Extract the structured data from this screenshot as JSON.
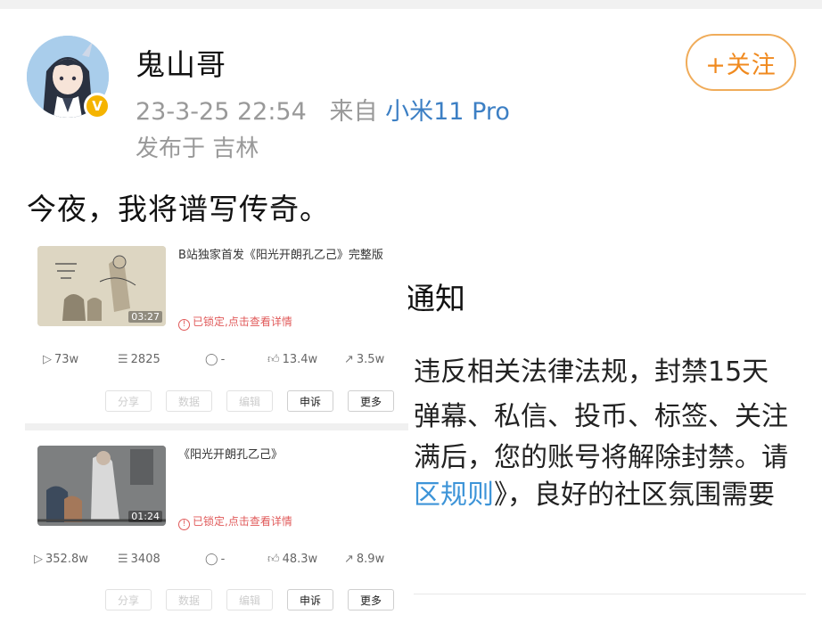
{
  "post": {
    "username": "鬼山哥",
    "timestamp": "23-3-25 22:54",
    "source_prefix": "来自",
    "device": "小米11 Pro",
    "location": "发布于 吉林",
    "follow_label": "+关注",
    "verified_icon": "v-badge-icon",
    "text": "今夜，我将谱写传奇。"
  },
  "videos": [
    {
      "title": "B站独家首发《阳光开朗孔乙己》完整版",
      "duration": "03:27",
      "lock_notice": "已锁定,点击查看详情",
      "stats": {
        "plays": "73w",
        "danmaku": "2825",
        "comments": "-",
        "likes": "13.4w",
        "shares": "3.5w"
      },
      "buttons": [
        "分享",
        "数据",
        "编辑",
        "申诉",
        "更多"
      ]
    },
    {
      "title": "《阳光开朗孔乙己》",
      "duration": "01:24",
      "lock_notice": "已锁定,点击查看详情",
      "stats": {
        "plays": "352.8w",
        "danmaku": "3408",
        "comments": "-",
        "likes": "48.3w",
        "shares": "8.9w"
      },
      "buttons": [
        "分享",
        "数据",
        "编辑",
        "申诉",
        "更多"
      ]
    }
  ],
  "notice": {
    "title": "通知",
    "lines": [
      "违反相关法律法规，封禁15天",
      "弹幕、私信、投币、标签、关注",
      "满后，您的账号将解除封禁。请",
      "区规则》，良好的社区氛围需要"
    ],
    "link_text": "区规则",
    "line4_rest": "》，良好的社区氛围需要"
  },
  "colors": {
    "accent_orange": "#f08a1f",
    "link_blue": "#3c7fc4",
    "lock_red": "#e05a5a"
  }
}
